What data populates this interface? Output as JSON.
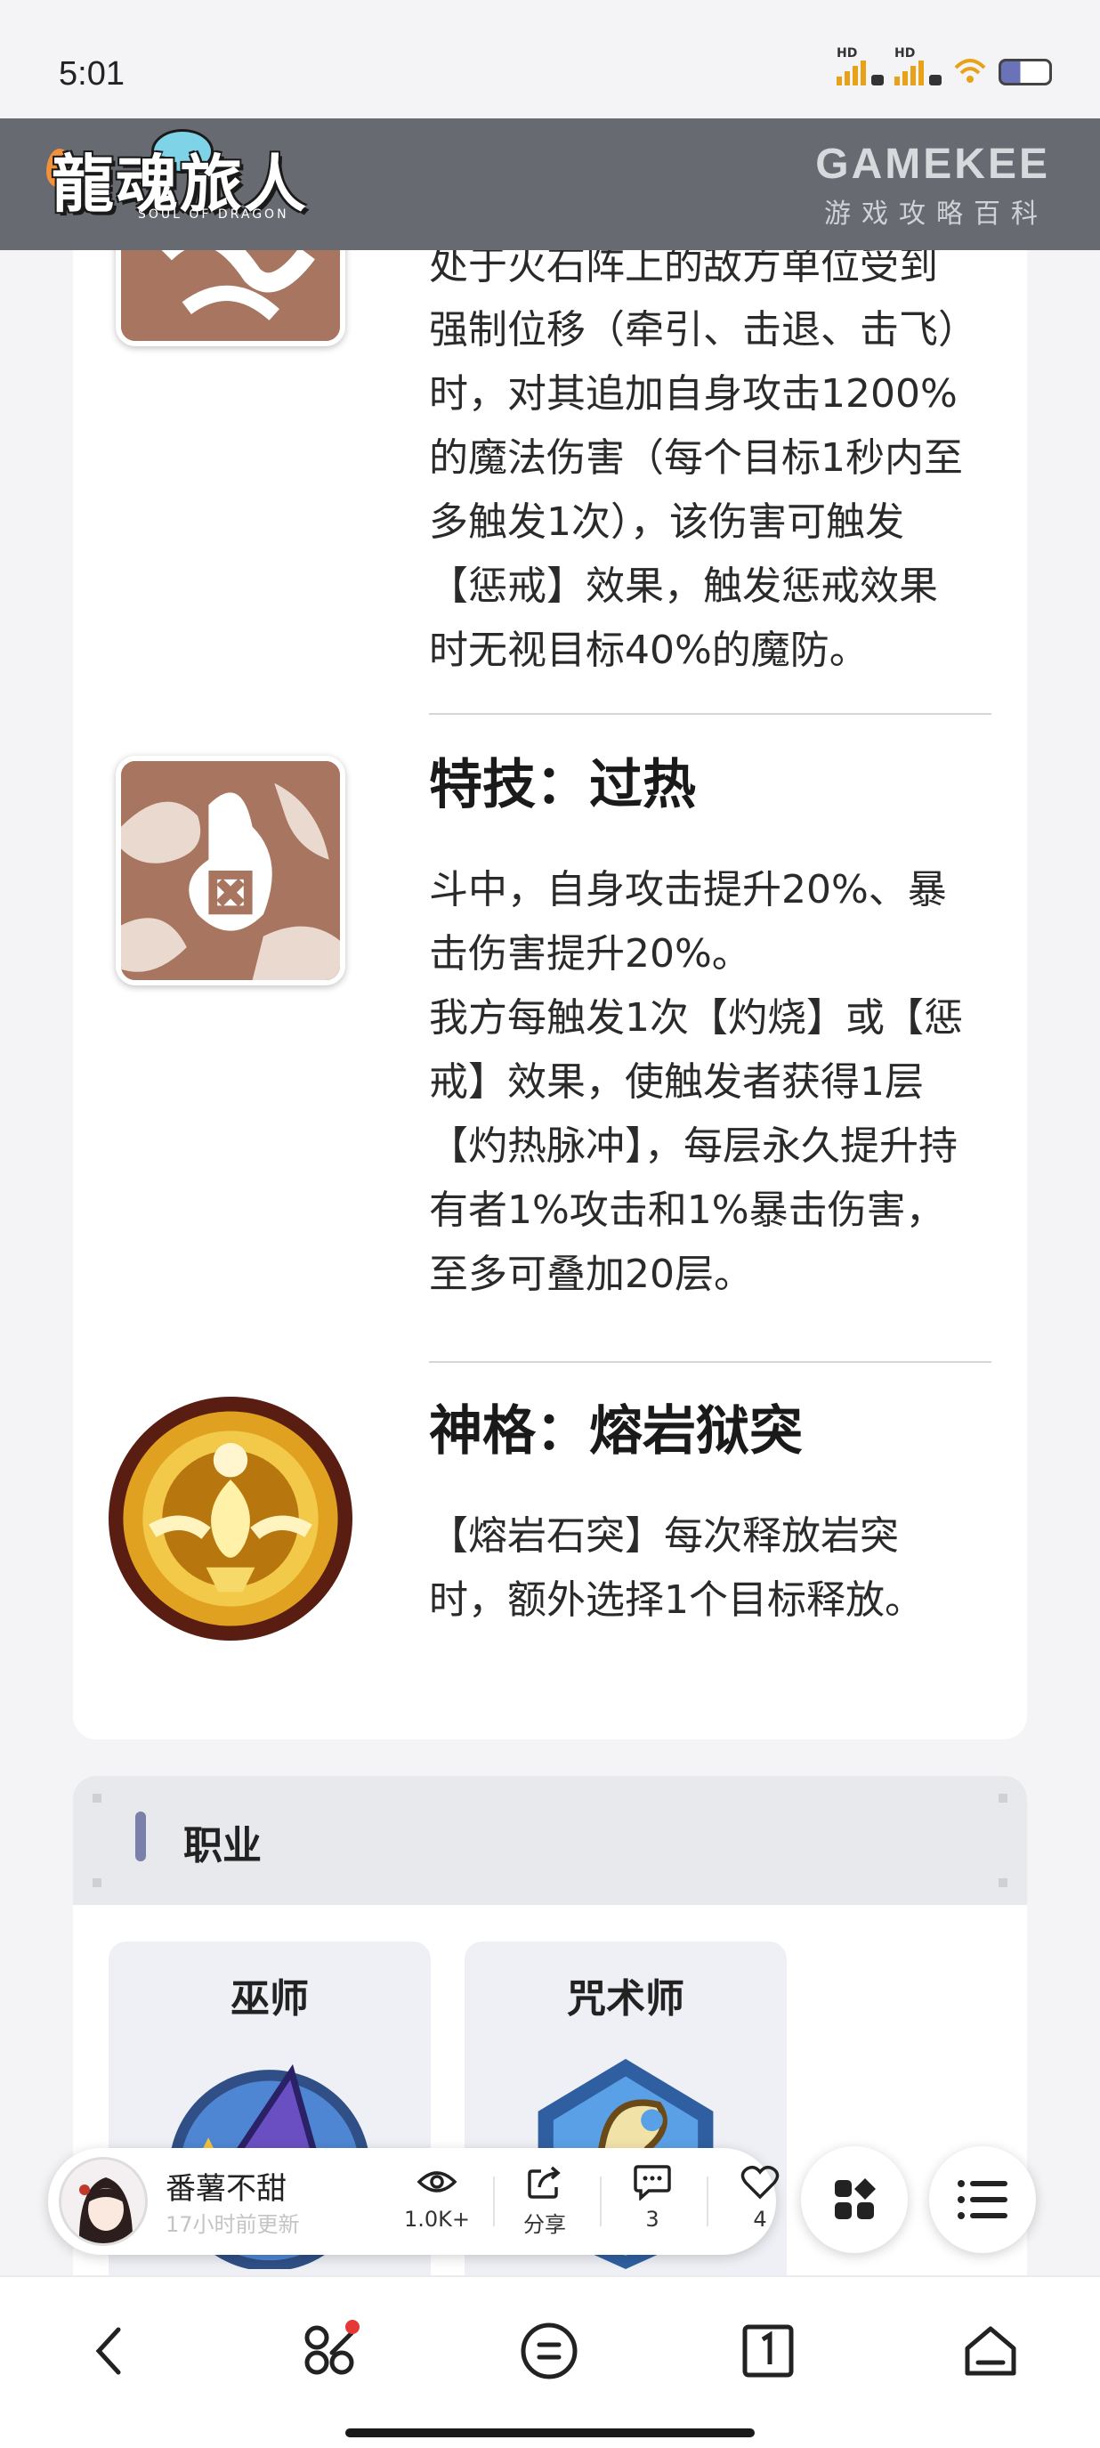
{
  "status_bar": {
    "time": "5:01",
    "hd1": "HD",
    "hd2": "HD"
  },
  "banner": {
    "logo_text": "龍魂旅人",
    "logo_sub": "SOUL OF DRAGON",
    "site_name": "GAMEKEE",
    "site_tagline": "游戏攻略百科"
  },
  "skills": [
    {
      "icon": "skill-swirl-icon",
      "partial": true,
      "description": "处于火石阵上的敌方单位受到\n强制位移（牵引、击退、击飞）\n时，对其追加自身攻击1200%\n的魔法伤害（每个目标1秒内至\n多触发1次），该伤害可触发\n【惩戒】效果，触发惩戒效果\n时无视目标40%的魔防。"
    },
    {
      "icon": "skill-overheat-icon",
      "title": "特技：过热",
      "description": "斗中，自身攻击提升20%、暴\n击伤害提升20%。\n我方每触发1次【灼烧】或【惩\n戒】效果，使触发者获得1层\n【灼热脉冲】，每层永久提升持\n有者1%攻击和1%暴击伤害，\n至多可叠加20层。"
    },
    {
      "icon": "divinity-medal-icon",
      "title": "神格：熔岩狱突",
      "description": "【熔岩石突】每次释放岩突\n时，额外选择1个目标释放。"
    }
  ],
  "job_section": {
    "title": "职业",
    "items": [
      {
        "name": "巫师",
        "icon": "wizard-emblem-icon"
      },
      {
        "name": "咒术师",
        "icon": "warlock-emblem-icon"
      }
    ]
  },
  "author_bar": {
    "name": "番薯不甜",
    "updated": "17小时前更新",
    "views": "1.0K+",
    "share": "分享",
    "comments": "3",
    "likes": "4"
  },
  "colors": {
    "banner": "#676a70",
    "skill_bg": "#a87560",
    "accent_bar": "#7a80a8",
    "notification": "#e53935"
  }
}
